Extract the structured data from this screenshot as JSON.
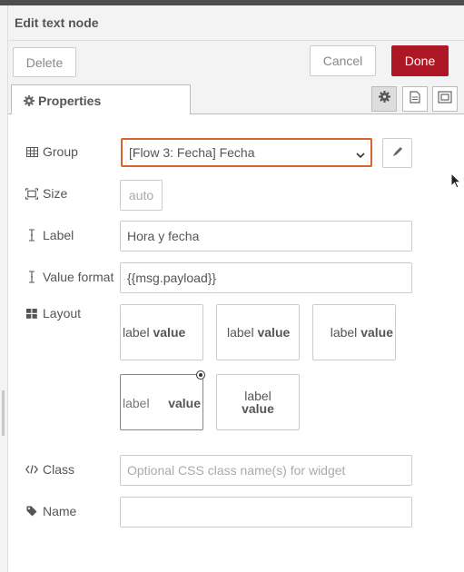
{
  "dialog": {
    "title": "Edit text node"
  },
  "toolbar": {
    "delete_label": "Delete",
    "cancel_label": "Cancel",
    "done_label": "Done"
  },
  "tabs": {
    "properties_label": "Properties"
  },
  "form": {
    "group": {
      "label": "Group",
      "value": "[Flow 3: Fecha] Fecha"
    },
    "size": {
      "label": "Size",
      "value": "auto"
    },
    "label": {
      "label": "Label",
      "value": "Hora y fecha"
    },
    "value_format": {
      "label": "Value format",
      "value": "{{msg.payload}}"
    },
    "layout": {
      "label": "Layout",
      "options": [
        {
          "label": "label",
          "value": "value"
        },
        {
          "label": "label",
          "value": "value"
        },
        {
          "label": "label",
          "value": "value"
        },
        {
          "label": "label",
          "value": "value",
          "selected": true
        },
        {
          "label": "label",
          "value": "value"
        }
      ]
    },
    "class": {
      "label": "Class",
      "placeholder": "Optional CSS class name(s) for widget"
    },
    "name": {
      "label": "Name",
      "value": ""
    }
  },
  "colors": {
    "accent": "#ad1625",
    "focus_border": "#d9642b"
  }
}
